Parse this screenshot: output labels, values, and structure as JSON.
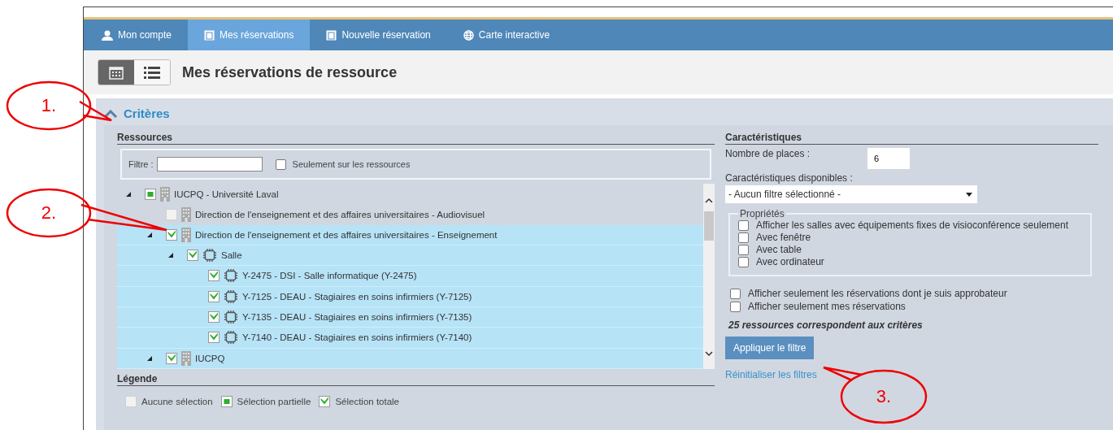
{
  "nav": {
    "tabs": [
      {
        "label": "Mon compte",
        "kind": "user",
        "selected": false
      },
      {
        "label": "Mes réservations",
        "kind": "square",
        "selected": true
      },
      {
        "label": "Nouvelle réservation",
        "kind": "square",
        "selected": false
      },
      {
        "label": "Carte interactive",
        "kind": "globe",
        "selected": false
      }
    ]
  },
  "view_toggle": [
    {
      "kind": "calendar",
      "selected": true
    },
    {
      "kind": "list",
      "selected": false
    }
  ],
  "page_title": "Mes réservations de ressource",
  "criteria": {
    "title": "Critères",
    "expanded": true,
    "resources": {
      "heading": "Ressources",
      "filter_label": "Filtre :",
      "only_resources": {
        "label": "Seulement sur les ressources",
        "checked": false
      },
      "tree": [
        {
          "label": "IUCPQ - Université Laval",
          "kind": "building",
          "checked": false,
          "partial": true,
          "selected": false,
          "expanded": true,
          "children": [
            {
              "label": "Direction de l'enseignement et des affaires universitaires - Audiovisuel",
              "kind": "building",
              "checked": false,
              "partial": false,
              "selected": false,
              "expanded": false
            },
            {
              "label": "Direction de l'enseignement et des affaires universitaires - Enseignement",
              "kind": "building",
              "checked": true,
              "partial": false,
              "selected": true,
              "expanded": true,
              "children": [
                {
                  "label": "Salle",
                  "kind": "room",
                  "checked": true,
                  "partial": false,
                  "selected": true,
                  "expanded": true,
                  "children": [
                    {
                      "label": "Y-2475 - DSI - Salle informatique (Y-2475)",
                      "kind": "room",
                      "checked": true,
                      "partial": false,
                      "selected": true
                    },
                    {
                      "label": "Y-7125 - DEAU - Stagiaires en soins infirmiers (Y-7125)",
                      "kind": "room",
                      "checked": true,
                      "partial": false,
                      "selected": true
                    },
                    {
                      "label": "Y-7135 - DEAU - Stagiaires en soins infirmiers (Y-7135)",
                      "kind": "room",
                      "checked": true,
                      "partial": false,
                      "selected": true
                    },
                    {
                      "label": "Y-7140 - DEAU - Stagiaires en soins infirmiers (Y-7140)",
                      "kind": "room",
                      "checked": true,
                      "partial": false,
                      "selected": true
                    }
                  ]
                }
              ]
            },
            {
              "label": "IUCPQ",
              "kind": "building",
              "checked": true,
              "partial": false,
              "selected": true,
              "expanded": true
            }
          ]
        }
      ],
      "legend": {
        "heading": "Légende",
        "items": [
          {
            "label": "Aucune sélection",
            "checked": false,
            "partial": false
          },
          {
            "label": "Sélection partielle",
            "checked": false,
            "partial": true
          },
          {
            "label": "Sélection totale",
            "checked": true,
            "partial": false
          }
        ]
      }
    },
    "characteristics": {
      "heading": "Caractéristiques",
      "places_label": "Nombre de places :",
      "places_value": "6",
      "available_label": "Caractéristiques disponibles :",
      "available_value": "- Aucun filtre sélectionné -",
      "properties": {
        "legend": "Propriétés",
        "options": [
          {
            "label": "Afficher les salles avec équipements fixes de visioconférence seulement",
            "checked": false
          },
          {
            "label": "Avec fenêtre",
            "checked": false
          },
          {
            "label": "Avec table",
            "checked": false
          },
          {
            "label": "Avec ordinateur",
            "checked": false
          }
        ]
      },
      "options": [
        {
          "label": "Afficher seulement les réservations dont je suis approbateur",
          "checked": false
        },
        {
          "label": "Afficher seulement mes réservations",
          "checked": false
        }
      ],
      "count": "25 ressources correspondent aux critères",
      "apply_button": "Appliquer le filtre",
      "reset_link": "Réinitialiser les filtres"
    }
  },
  "callouts": [
    {
      "label": "1."
    },
    {
      "label": "2."
    },
    {
      "label": "3."
    }
  ]
}
